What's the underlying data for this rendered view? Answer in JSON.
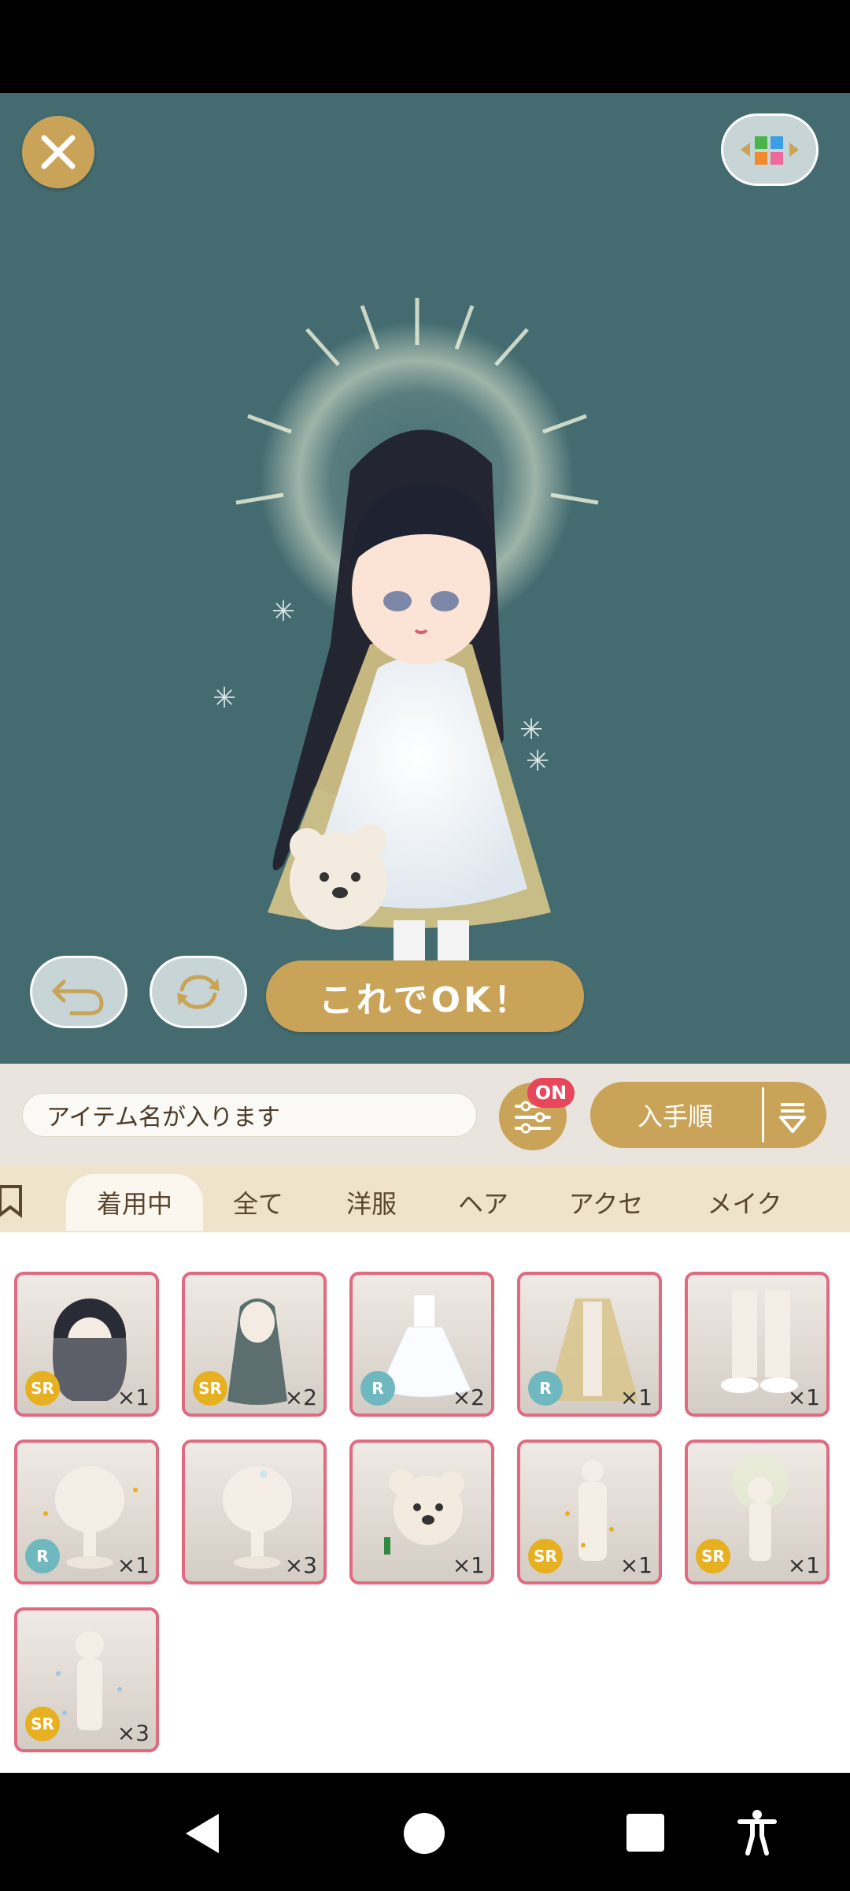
{
  "toolbar": {
    "search_placeholder": "アイテム名が入ります",
    "filter_badge": "ON",
    "sort_label": "入手順"
  },
  "stage": {
    "ok_button_label": "これでOK！"
  },
  "tabs": [
    {
      "label": "着用中",
      "active": true
    },
    {
      "label": "全て",
      "active": false
    },
    {
      "label": "洋服",
      "active": false
    },
    {
      "label": "ヘア",
      "active": false
    },
    {
      "label": "アクセ",
      "active": false
    },
    {
      "label": "メイク",
      "active": false
    }
  ],
  "items": [
    {
      "rarity": "SR",
      "count": "×1",
      "icon": "black-wavy-hair"
    },
    {
      "rarity": "SR",
      "count": "×2",
      "icon": "long-dark-teal-hair"
    },
    {
      "rarity": "R",
      "count": "×2",
      "icon": "white-flower-dress"
    },
    {
      "rarity": "R",
      "count": "×1",
      "icon": "gold-lace-cape"
    },
    {
      "rarity": "",
      "count": "×1",
      "icon": "white-boots"
    },
    {
      "rarity": "R",
      "count": "×1",
      "icon": "sparkle-head-accessory"
    },
    {
      "rarity": "",
      "count": "×3",
      "icon": "head-accessory"
    },
    {
      "rarity": "",
      "count": "×1",
      "icon": "bear-plush"
    },
    {
      "rarity": "SR",
      "count": "×1",
      "icon": "gold-sparkle-effect"
    },
    {
      "rarity": "SR",
      "count": "×1",
      "icon": "halo-effect"
    },
    {
      "rarity": "SR",
      "count": "×3",
      "icon": "blue-sparkle-effect"
    }
  ],
  "colors": {
    "stage_bg": "#436b70",
    "gold": "#c9a458",
    "badge_red": "#e8465a",
    "item_border": "#e06b80"
  }
}
